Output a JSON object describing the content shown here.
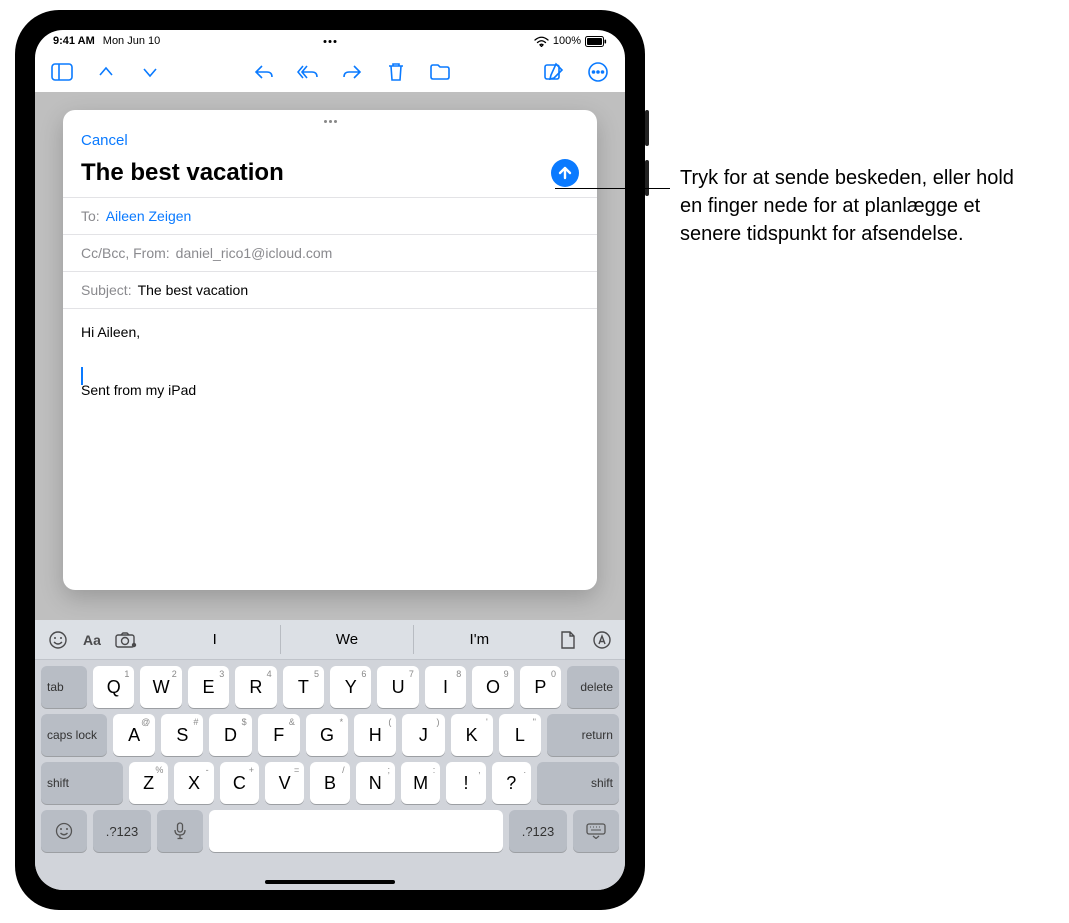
{
  "status": {
    "time": "9:41 AM",
    "date": "Mon Jun 10",
    "battery_pct": "100%"
  },
  "compose": {
    "cancel": "Cancel",
    "title": "The best vacation",
    "to_label": "To:",
    "to_value": "Aileen Zeigen",
    "ccbcc_label": "Cc/Bcc, From:",
    "ccbcc_value": "daniel_rico1@icloud.com",
    "subject_label": "Subject:",
    "subject_value": "The best vacation",
    "body_greeting": "Hi Aileen,",
    "signature": "Sent from my iPad"
  },
  "suggestions": {
    "words": [
      "I",
      "We",
      "I'm"
    ]
  },
  "keyboard": {
    "row1": [
      {
        "main": "Q",
        "sup": "1"
      },
      {
        "main": "W",
        "sup": "2"
      },
      {
        "main": "E",
        "sup": "3"
      },
      {
        "main": "R",
        "sup": "4"
      },
      {
        "main": "T",
        "sup": "5"
      },
      {
        "main": "Y",
        "sup": "6"
      },
      {
        "main": "U",
        "sup": "7"
      },
      {
        "main": "I",
        "sup": "8"
      },
      {
        "main": "O",
        "sup": "9"
      },
      {
        "main": "P",
        "sup": "0"
      }
    ],
    "row2": [
      {
        "main": "A",
        "sup": "@"
      },
      {
        "main": "S",
        "sup": "#"
      },
      {
        "main": "D",
        "sup": "$"
      },
      {
        "main": "F",
        "sup": "&"
      },
      {
        "main": "G",
        "sup": "*"
      },
      {
        "main": "H",
        "sup": "("
      },
      {
        "main": "J",
        "sup": ")"
      },
      {
        "main": "K",
        "sup": "'"
      },
      {
        "main": "L",
        "sup": "\""
      }
    ],
    "row3": [
      {
        "main": "Z",
        "sup": "%"
      },
      {
        "main": "X",
        "sup": "-"
      },
      {
        "main": "C",
        "sup": "+"
      },
      {
        "main": "V",
        "sup": "="
      },
      {
        "main": "B",
        "sup": "/"
      },
      {
        "main": "N",
        "sup": ";"
      },
      {
        "main": "M",
        "sup": ":"
      }
    ],
    "tab": "tab",
    "delete": "delete",
    "caps": "caps lock",
    "return": "return",
    "shift": "shift",
    "numbers": ".?123",
    "punct1": {
      "main": "!",
      "sup": ","
    },
    "punct2": {
      "main": "?",
      "sup": "."
    }
  },
  "callout": {
    "text": "Tryk for at sende beskeden, eller hold en finger nede for at planlægge et senere tidspunkt for afsendelse."
  }
}
